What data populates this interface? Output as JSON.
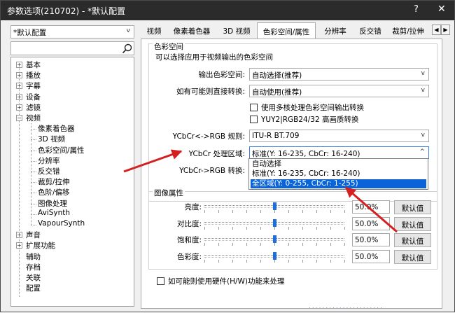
{
  "window": {
    "title": "参数选项(210702) - *默认配置",
    "help": "?",
    "close": "✕"
  },
  "profile_combo": {
    "value": "*默认配置"
  },
  "search": {
    "placeholder": ""
  },
  "tree": {
    "top": [
      "基本",
      "播放",
      "字幕",
      "设备",
      "滤镜",
      "视频"
    ],
    "video_children": [
      "像素着色器",
      "3D 视频",
      "色彩空间/属性",
      "分辨率",
      "反交错",
      "裁剪/拉伸",
      "色阶/偏移",
      "图像处理",
      "AviSynth",
      "VapourSynth"
    ],
    "bottom": [
      "声音",
      "扩展功能",
      "辅助",
      "存档",
      "关联",
      "配置"
    ]
  },
  "tabs": [
    "视频",
    "像素着色器",
    "3D 视频",
    "色彩空间/属性",
    "分辨率",
    "反交错",
    "裁剪/拉伸"
  ],
  "color_space": {
    "section_title": "色彩空间",
    "description": "可以选择应用于视频输出的色彩空间",
    "output_label": "输出色彩空间:",
    "output_value": "自动选择(推荐)",
    "direct_label": "如有可能则直接转换:",
    "direct_value": "自动使用(推荐)",
    "multicore_label": "使用多核处理色彩空间输出转换",
    "yuy2_label": "YUY2|RGB24/32 高画质转换",
    "rgb_rule_label": "YCbCr<->RGB 规则:",
    "rgb_rule_value": "ITU-R BT.709",
    "range_label": "YCbCr 处理区域:",
    "range_value": "标准(Y: 16-235, CbCr: 16-240)",
    "conv_label": "YCbCr->RGB 转换:",
    "range_options": [
      "自动选择",
      "标准(Y: 16-235, CbCr: 16-240)",
      "全区域(Y: 0-255, CbCr: 1-255)"
    ],
    "selected_option_index": 2
  },
  "image_props": {
    "section_title": "图像属性",
    "rows": [
      {
        "label": "亮度:",
        "value": "50.0%",
        "button": "默认值",
        "level": 0.5
      },
      {
        "label": "对比度:",
        "value": "50.0%",
        "button": "默认值",
        "level": 0.5
      },
      {
        "label": "饱和度:",
        "value": "50.0%",
        "button": "默认值",
        "level": 0.5
      },
      {
        "label": "色彩度:",
        "value": "50.0%",
        "button": "默认值",
        "level": 0.5
      }
    ]
  },
  "hw_label": "如可能则使用硬件(H/W)功能来处理",
  "accent_color": "#0a64d8",
  "arrow_color": "#d42020"
}
